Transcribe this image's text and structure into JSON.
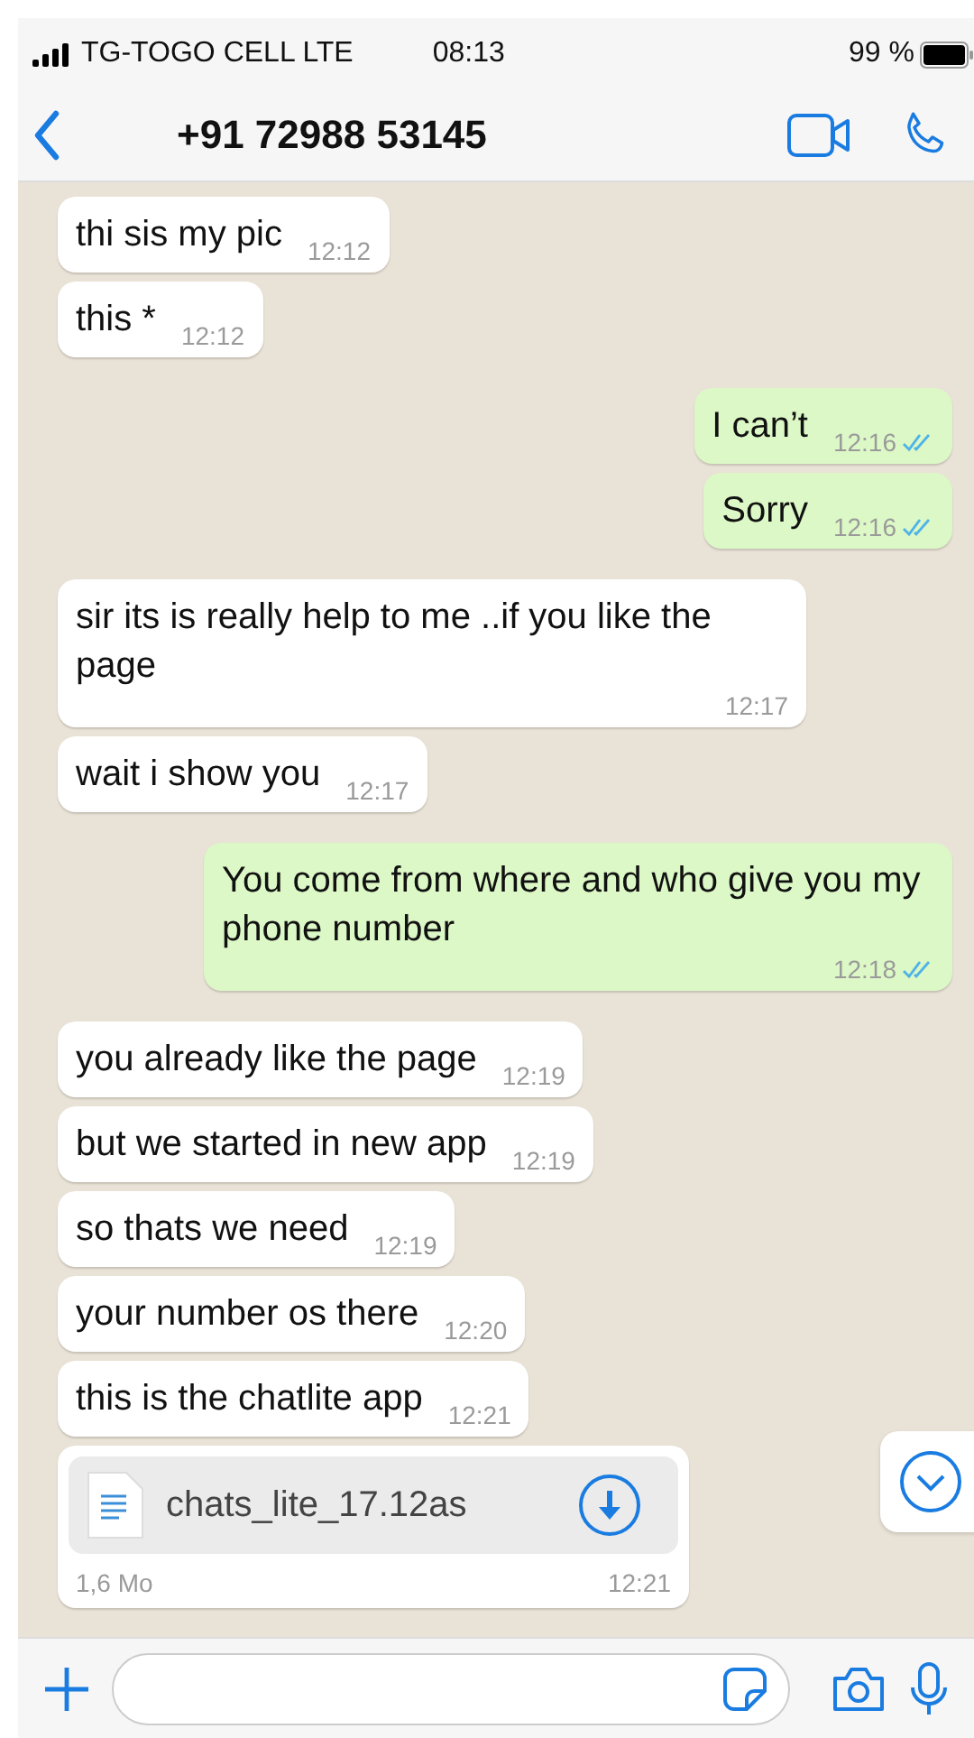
{
  "status_bar": {
    "carrier": "TG-TOGO CELL LTE",
    "time": "08:13",
    "battery": "99 %"
  },
  "header": {
    "title": "+91 72988 53145"
  },
  "messages": [
    {
      "kind": "in",
      "text": "thi sis my pic",
      "time": "12:12"
    },
    {
      "kind": "in",
      "text": "this *",
      "time": "12:12"
    },
    {
      "kind": "out",
      "text": "I can’t",
      "time": "12:16",
      "read": true
    },
    {
      "kind": "out",
      "text": "Sorry",
      "time": "12:16",
      "read": true
    },
    {
      "kind": "in",
      "text": "sir its is really help to me ..if you like the page",
      "time": "12:17"
    },
    {
      "kind": "in",
      "text": "wait i show you",
      "time": "12:17"
    },
    {
      "kind": "out",
      "text": "You come from where and who give you my phone number",
      "time": "12:18",
      "read": true
    },
    {
      "kind": "in",
      "text": "you already like the page",
      "time": "12:19"
    },
    {
      "kind": "in",
      "text": "but we started in new app",
      "time": "12:19"
    },
    {
      "kind": "in",
      "text": "so thats we need",
      "time": "12:19"
    },
    {
      "kind": "in",
      "text": "your number os there",
      "time": "12:20"
    },
    {
      "kind": "in",
      "text": "this is the chatlite app",
      "time": "12:21"
    },
    {
      "kind": "file",
      "text": "chats_lite_17.12as",
      "size": "1,6 Mo",
      "time": "12:21"
    }
  ]
}
